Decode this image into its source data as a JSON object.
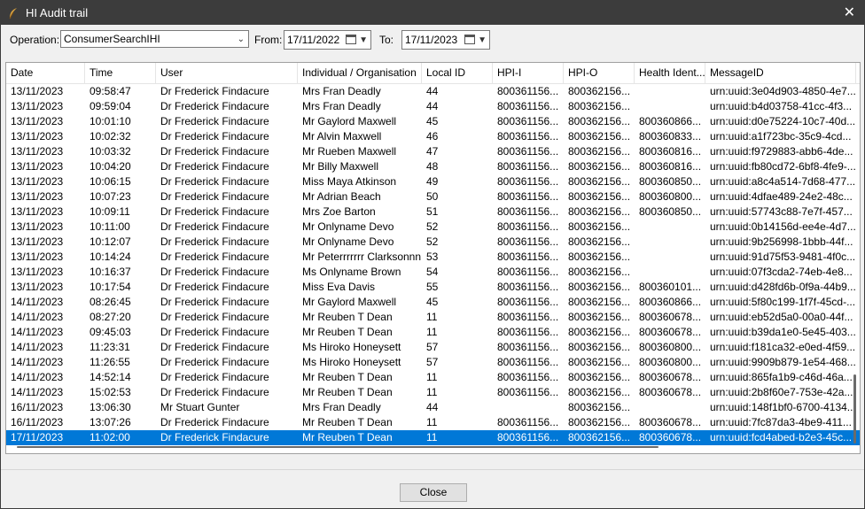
{
  "window": {
    "title": "HI Audit trail",
    "close_symbol": "✕"
  },
  "toolbar": {
    "operation_label": "Operation:",
    "operation_value": "ConsumerSearchIHI",
    "from_label": "From:",
    "from_value": "17/11/2022",
    "to_label": "To:",
    "to_value": "17/11/2023"
  },
  "table": {
    "columns": [
      "Date",
      "Time",
      "User",
      "Individual / Organisation",
      "Local ID",
      "HPI-I",
      "HPI-O",
      "Health Ident...",
      "MessageID"
    ],
    "selected_index": 23,
    "rows": [
      [
        "13/11/2023",
        "09:58:47",
        "Dr Frederick Findacure",
        "Mrs Fran Deadly",
        "44",
        "800361156...",
        "800362156...",
        "",
        "urn:uuid:3e04d903-4850-4e7..."
      ],
      [
        "13/11/2023",
        "09:59:04",
        "Dr Frederick Findacure",
        "Mrs Fran Deadly",
        "44",
        "800361156...",
        "800362156...",
        "",
        "urn:uuid:b4d03758-41cc-4f3..."
      ],
      [
        "13/11/2023",
        "10:01:10",
        "Dr Frederick Findacure",
        "Mr Gaylord Maxwell",
        "45",
        "800361156...",
        "800362156...",
        "800360866...",
        "urn:uuid:d0e75224-10c7-40d..."
      ],
      [
        "13/11/2023",
        "10:02:32",
        "Dr Frederick Findacure",
        "Mr Alvin Maxwell",
        "46",
        "800361156...",
        "800362156...",
        "800360833...",
        "urn:uuid:a1f723bc-35c9-4cd..."
      ],
      [
        "13/11/2023",
        "10:03:32",
        "Dr Frederick Findacure",
        "Mr Rueben Maxwell",
        "47",
        "800361156...",
        "800362156...",
        "800360816...",
        "urn:uuid:f9729883-abb6-4de..."
      ],
      [
        "13/11/2023",
        "10:04:20",
        "Dr Frederick Findacure",
        "Mr Billy Maxwell",
        "48",
        "800361156...",
        "800362156...",
        "800360816...",
        "urn:uuid:fb80cd72-6bf8-4fe9-..."
      ],
      [
        "13/11/2023",
        "10:06:15",
        "Dr Frederick Findacure",
        "Miss Maya Atkinson",
        "49",
        "800361156...",
        "800362156...",
        "800360850...",
        "urn:uuid:a8c4a514-7d68-477..."
      ],
      [
        "13/11/2023",
        "10:07:23",
        "Dr Frederick Findacure",
        "Mr Adrian Beach",
        "50",
        "800361156...",
        "800362156...",
        "800360800...",
        "urn:uuid:4dfae489-24e2-48c..."
      ],
      [
        "13/11/2023",
        "10:09:11",
        "Dr Frederick Findacure",
        "Mrs Zoe Barton",
        "51",
        "800361156...",
        "800362156...",
        "800360850...",
        "urn:uuid:57743c88-7e7f-457..."
      ],
      [
        "13/11/2023",
        "10:11:00",
        "Dr Frederick Findacure",
        "Mr Onlyname Devo",
        "52",
        "800361156...",
        "800362156...",
        "",
        "urn:uuid:0b14156d-ee4e-4d7..."
      ],
      [
        "13/11/2023",
        "10:12:07",
        "Dr Frederick Findacure",
        "Mr Onlyname Devo",
        "52",
        "800361156...",
        "800362156...",
        "",
        "urn:uuid:9b256998-1bbb-44f..."
      ],
      [
        "13/11/2023",
        "10:14:24",
        "Dr Frederick Findacure",
        "Mr Peterrrrrrr Clarksonnn...",
        "53",
        "800361156...",
        "800362156...",
        "",
        "urn:uuid:91d75f53-9481-4f0c..."
      ],
      [
        "13/11/2023",
        "10:16:37",
        "Dr Frederick Findacure",
        "Ms Onlyname Brown",
        "54",
        "800361156...",
        "800362156...",
        "",
        "urn:uuid:07f3cda2-74eb-4e8..."
      ],
      [
        "13/11/2023",
        "10:17:54",
        "Dr Frederick Findacure",
        "Miss Eva Davis",
        "55",
        "800361156...",
        "800362156...",
        "800360101...",
        "urn:uuid:d428fd6b-0f9a-44b9..."
      ],
      [
        "14/11/2023",
        "08:26:45",
        "Dr Frederick Findacure",
        "Mr Gaylord Maxwell",
        "45",
        "800361156...",
        "800362156...",
        "800360866...",
        "urn:uuid:5f80c199-1f7f-45cd-..."
      ],
      [
        "14/11/2023",
        "08:27:20",
        "Dr Frederick Findacure",
        "Mr Reuben T Dean",
        "11",
        "800361156...",
        "800362156...",
        "800360678...",
        "urn:uuid:eb52d5a0-00a0-44f..."
      ],
      [
        "14/11/2023",
        "09:45:03",
        "Dr Frederick Findacure",
        "Mr Reuben T Dean",
        "11",
        "800361156...",
        "800362156...",
        "800360678...",
        "urn:uuid:b39da1e0-5e45-403..."
      ],
      [
        "14/11/2023",
        "11:23:31",
        "Dr Frederick Findacure",
        "Ms Hiroko Honeysett",
        "57",
        "800361156...",
        "800362156...",
        "800360800...",
        "urn:uuid:f181ca32-e0ed-4f59..."
      ],
      [
        "14/11/2023",
        "11:26:55",
        "Dr Frederick Findacure",
        "Ms Hiroko Honeysett",
        "57",
        "800361156...",
        "800362156...",
        "800360800...",
        "urn:uuid:9909b879-1e54-468..."
      ],
      [
        "14/11/2023",
        "14:52:14",
        "Dr Frederick Findacure",
        "Mr Reuben T Dean",
        "11",
        "800361156...",
        "800362156...",
        "800360678...",
        "urn:uuid:865fa1b9-c46d-46a..."
      ],
      [
        "14/11/2023",
        "15:02:53",
        "Dr Frederick Findacure",
        "Mr Reuben T Dean",
        "11",
        "800361156...",
        "800362156...",
        "800360678...",
        "urn:uuid:2b8f60e7-753e-42a..."
      ],
      [
        "16/11/2023",
        "13:06:30",
        "Mr Stuart Gunter",
        "Mrs Fran Deadly",
        "44",
        "",
        "800362156...",
        "",
        "urn:uuid:148f1bf0-6700-4134..."
      ],
      [
        "16/11/2023",
        "13:07:26",
        "Dr Frederick Findacure",
        "Mr Reuben T Dean",
        "11",
        "800361156...",
        "800362156...",
        "800360678...",
        "urn:uuid:7fc87da3-4be9-411..."
      ],
      [
        "17/11/2023",
        "11:02:00",
        "Dr Frederick Findacure",
        "Mr Reuben T Dean",
        "11",
        "800361156...",
        "800362156...",
        "800360678...",
        "urn:uuid:fcd4abed-b2e3-45c..."
      ]
    ]
  },
  "footer": {
    "close_label": "Close"
  },
  "colors": {
    "titlebar": "#3c3c3c",
    "selection": "#0078d7"
  }
}
